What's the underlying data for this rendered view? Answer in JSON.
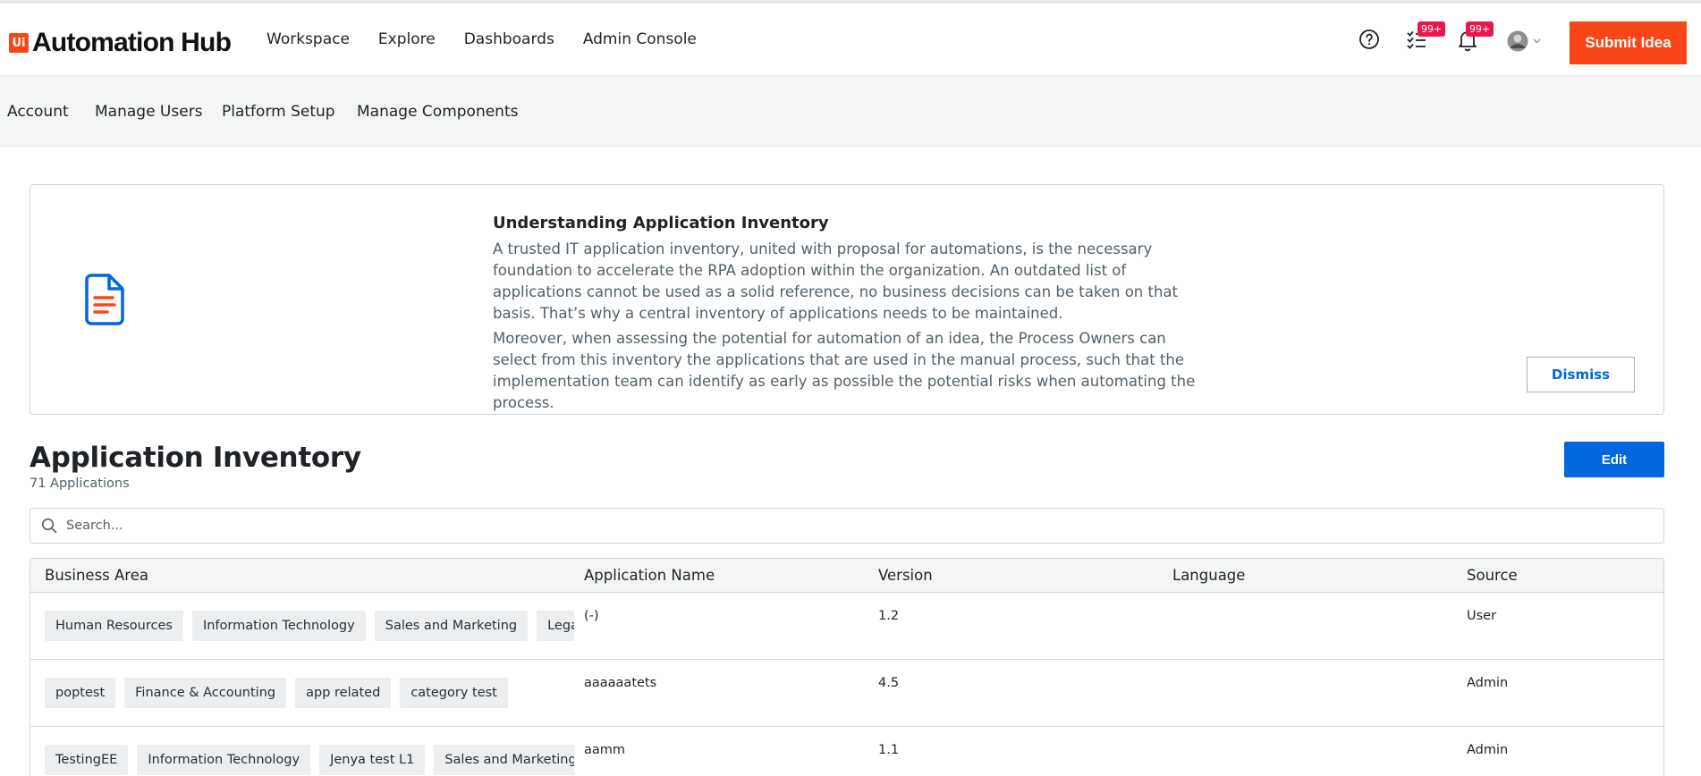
{
  "brand": {
    "badge": "Ui",
    "name": "Automation Hub",
    "accent": "#fa4616"
  },
  "header": {
    "nav": [
      {
        "label": "Workspace"
      },
      {
        "label": "Explore"
      },
      {
        "label": "Dashboards"
      },
      {
        "label": "Admin Console"
      }
    ],
    "icons": {
      "help": "help-circle-icon",
      "tasks": "task-checklist-icon",
      "tasks_badge": "99+",
      "notifications": "bell-icon",
      "notifications_badge": "99+",
      "avatar": "user-avatar",
      "avatar_menu": "chevron-down-icon"
    },
    "submit_label": "Submit Idea"
  },
  "subnav": {
    "items": [
      {
        "label": "Account"
      },
      {
        "label": "Manage Users"
      },
      {
        "label": "Platform Setup"
      },
      {
        "label": "Manage Components"
      }
    ]
  },
  "banner": {
    "icon": "document-icon",
    "title": "Understanding Application Inventory",
    "paragraph1": "A trusted IT application inventory, united with proposal for automations, is the necessary foundation to accelerate the RPA adoption within the organization. An outdated list of applications cannot be used as a solid reference, no business decisions can be taken on that basis. That’s why a central inventory of applications needs to be maintained.",
    "paragraph2": "Moreover, when assessing the potential for automation of an idea, the Process Owners can select from this inventory the applications that are used in the manual process, such that the implementation team can identify as early as possible the potential risks when automating the process.",
    "dismiss_label": "Dismiss"
  },
  "inventory": {
    "title": "Application Inventory",
    "count_label": "71 Applications",
    "edit_label": "Edit",
    "search_placeholder": "Search...",
    "columns": {
      "business_area": "Business Area",
      "application_name": "Application Name",
      "version": "Version",
      "language": "Language",
      "source": "Source"
    },
    "rows": [
      {
        "tags": [
          "Human Resources",
          "Information Technology",
          "Sales and Marketing",
          "Legal"
        ],
        "application_name": "(-)",
        "version": "1.2",
        "language": "",
        "source": "User"
      },
      {
        "tags": [
          "poptest",
          "Finance & Accounting",
          "app related",
          "category test"
        ],
        "application_name": "aaaaaatets",
        "version": "4.5",
        "language": "",
        "source": "Admin"
      },
      {
        "tags": [
          "TestingEE",
          "Information Technology",
          "Jenya test L1",
          "Sales and Marketing"
        ],
        "application_name": "aamm",
        "version": "1.1",
        "language": "",
        "source": "Admin"
      }
    ]
  }
}
